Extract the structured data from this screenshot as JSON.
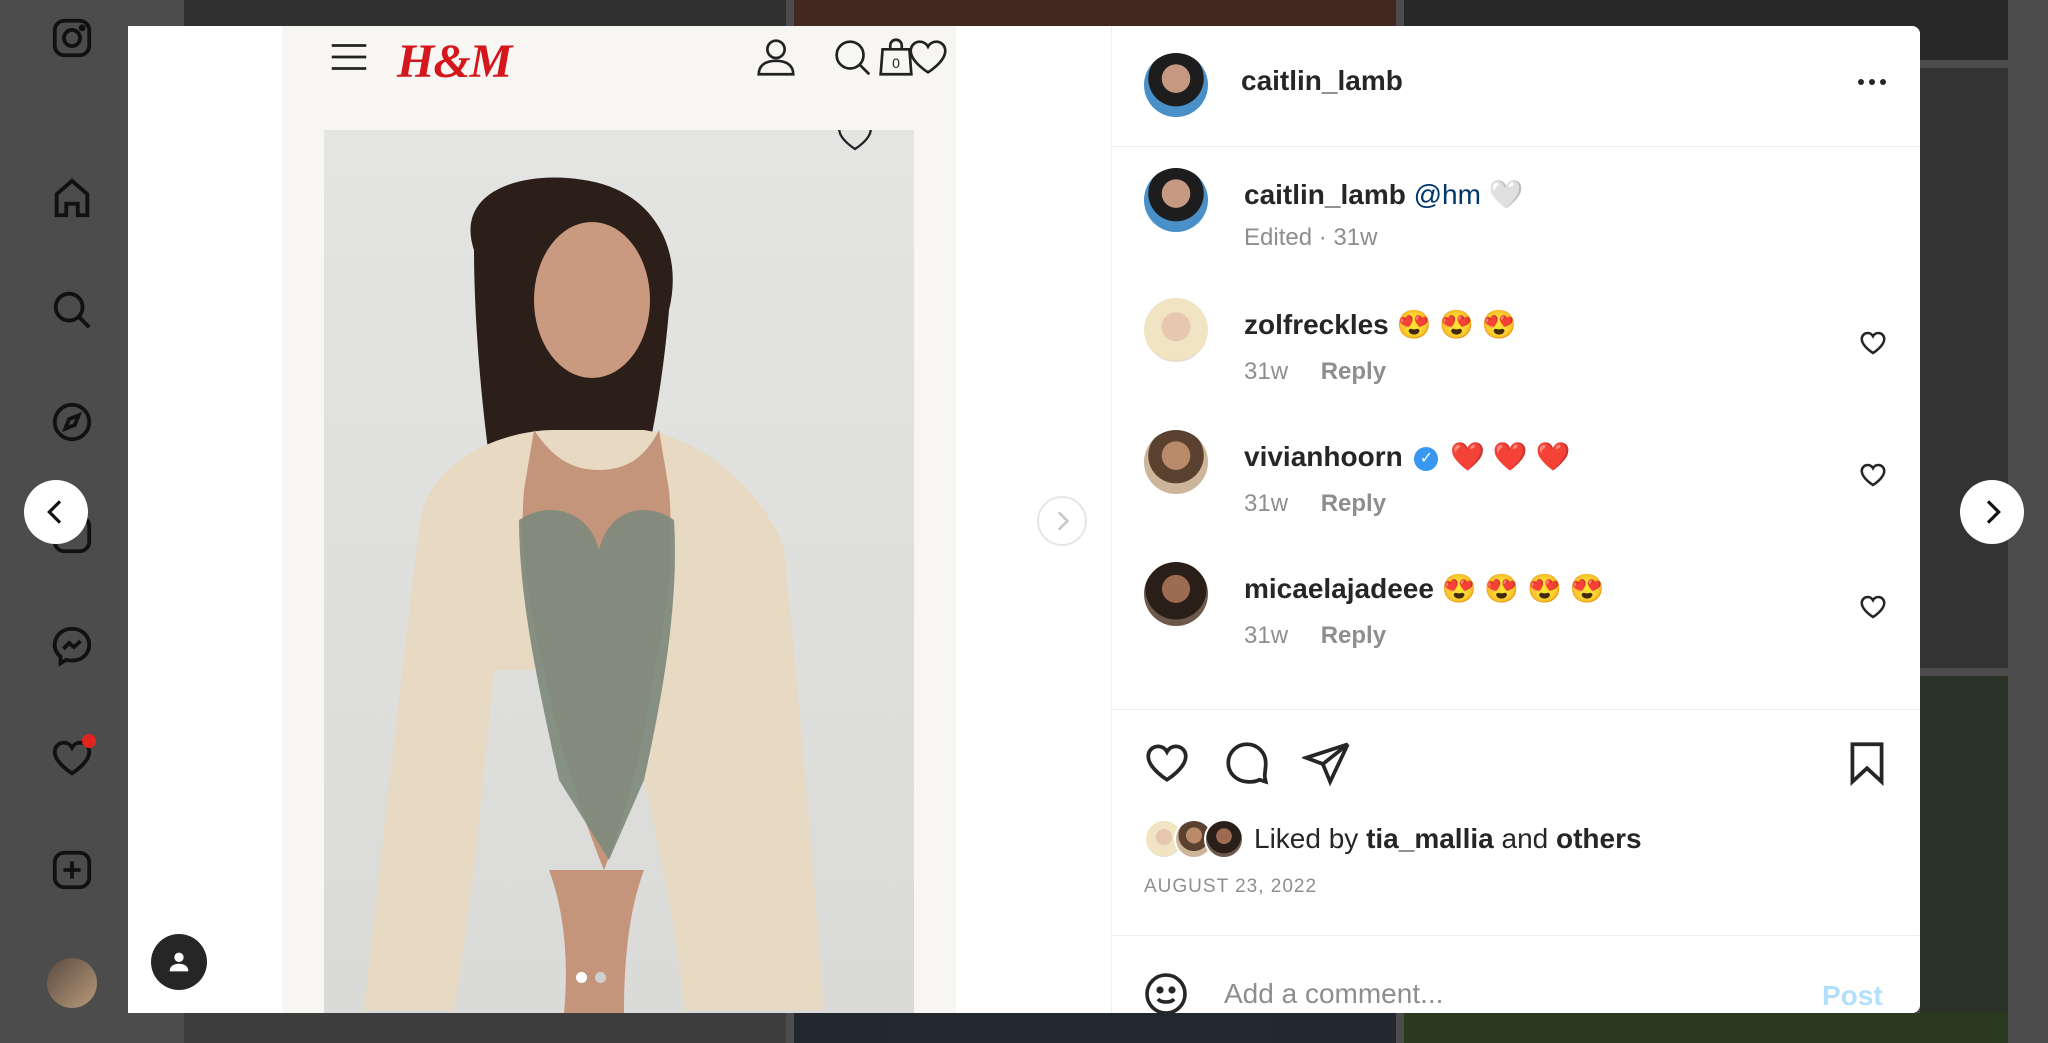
{
  "post": {
    "username": "caitlin_lamb",
    "caption_user": "caitlin_lamb",
    "caption_mention": "@hm",
    "caption_emoji": "🤍",
    "caption_meta": "Edited · 31w",
    "brand_logo": "H&M",
    "bag_count": "0"
  },
  "comments": [
    {
      "user": "zolfreckles",
      "emojis": "😍 😍 😍",
      "time": "31w",
      "reply": "Reply",
      "verified": false
    },
    {
      "user": "vivianhoorn",
      "emojis": "❤️ ❤️ ❤️",
      "time": "31w",
      "reply": "Reply",
      "verified": true
    },
    {
      "user": "micaelajadeee",
      "emojis": "😍 😍 😍 😍",
      "time": "31w",
      "reply": "Reply",
      "verified": false
    }
  ],
  "likes": {
    "prefix": "Liked by",
    "user": "tia_mallia",
    "conj": "and",
    "others": "others"
  },
  "date": "AUGUST 23, 2022",
  "comment_box": {
    "placeholder": "Add a comment...",
    "post_label": "Post"
  },
  "colors": {
    "brand_red": "#d3171c",
    "link_blue": "#00376b",
    "post_disabled": "#b2dffc",
    "notification": "#e0241f"
  }
}
